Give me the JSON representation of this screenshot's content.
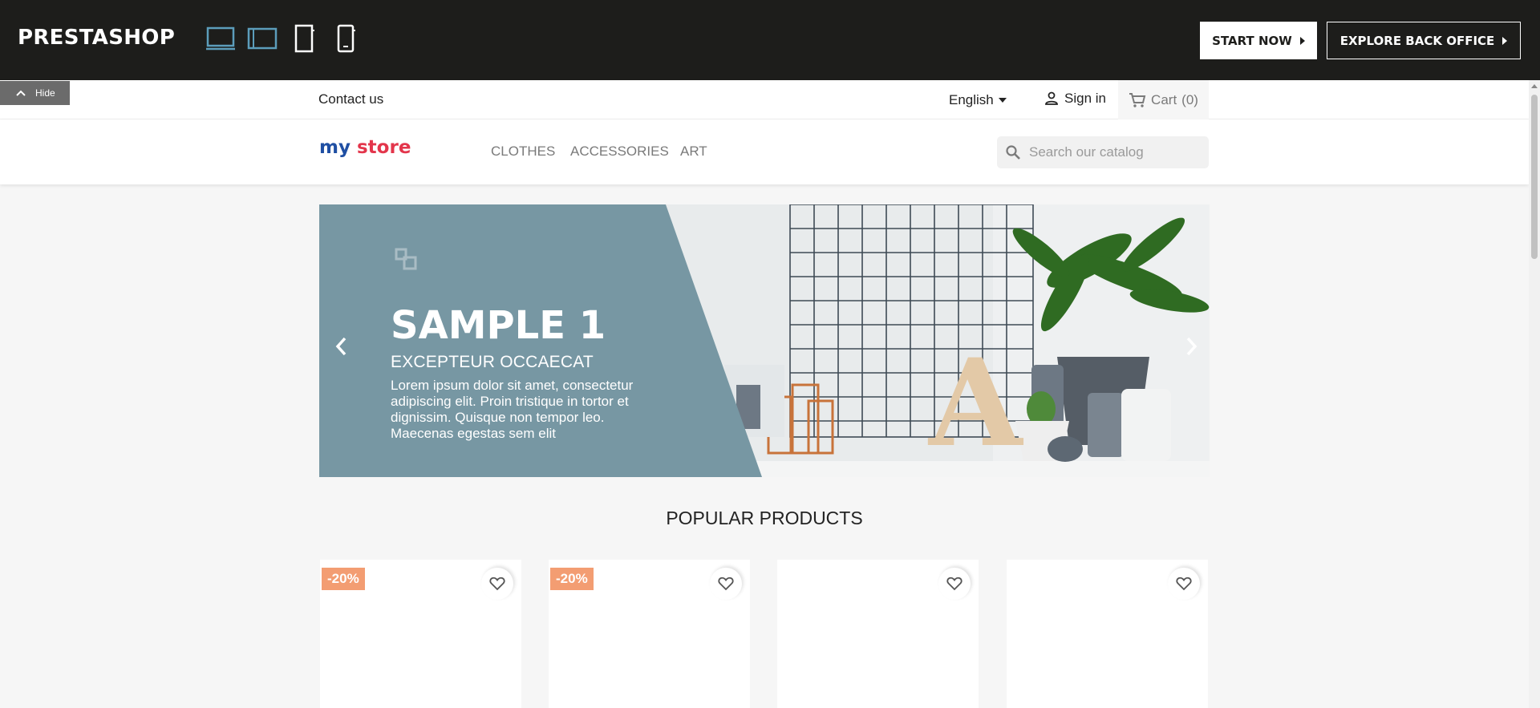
{
  "demo_bar": {
    "logo": "PRESTASHOP",
    "devices": [
      {
        "icon": "desktop-icon",
        "active": true
      },
      {
        "icon": "tablet-landscape-icon",
        "active": true
      },
      {
        "icon": "tablet-portrait-icon",
        "active": false
      },
      {
        "icon": "mobile-icon",
        "active": false
      }
    ],
    "start_label": "START NOW",
    "explore_label": "EXPLORE BACK OFFICE",
    "hide_label": "Hide"
  },
  "header": {
    "contact": "Contact us",
    "language": "English",
    "signin": "Sign in",
    "cart": "Cart",
    "cart_count": "(0)",
    "logo": {
      "my": "my",
      "store": "store"
    },
    "menu": [
      "CLOTHES",
      "ACCESSORIES",
      "ART"
    ],
    "search_placeholder": "Search our catalog"
  },
  "slider": {
    "title": "SAMPLE 1",
    "subtitle": "EXCEPTEUR OCCAECAT",
    "description": "Lorem ipsum dolor sit amet, consectetur adipiscing elit. Proin tristique in tortor et dignissim. Quisque non tempor leo. Maecenas egestas sem elit",
    "prev_icon": "chevron-left-icon",
    "next_icon": "chevron-right-icon"
  },
  "section": {
    "title": "POPULAR PRODUCTS"
  },
  "products": [
    {
      "badge": "-20%"
    },
    {
      "badge": "-20%"
    },
    {
      "badge": ""
    },
    {
      "badge": ""
    }
  ],
  "colors": {
    "demo_bar": "#1d1d1b",
    "slide_panel": "#7797a3",
    "badge": "#f39d72",
    "device_active": "#5c9dbb"
  }
}
